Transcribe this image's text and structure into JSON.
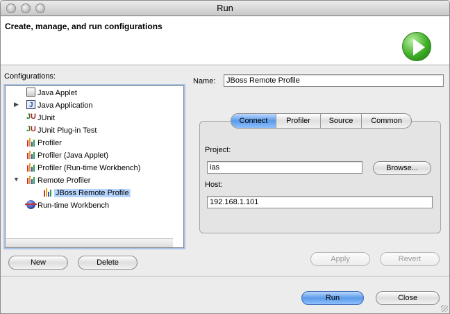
{
  "window": {
    "title": "Run"
  },
  "banner": {
    "title": "Create, manage, and run configurations"
  },
  "configurations": {
    "label": "Configurations:",
    "items": [
      {
        "label": "Java Applet",
        "icon": "applet-icon"
      },
      {
        "label": "Java Application",
        "icon": "java-app-icon",
        "collapsed": true
      },
      {
        "label": "JUnit",
        "icon": "junit-icon"
      },
      {
        "label": "JUnit Plug-in Test",
        "icon": "junit-plugin-icon"
      },
      {
        "label": "Profiler",
        "icon": "profiler-icon"
      },
      {
        "label": "Profiler (Java Applet)",
        "icon": "profiler-icon"
      },
      {
        "label": "Profiler (Run-time Workbench)",
        "icon": "profiler-icon"
      },
      {
        "label": "Remote Profiler",
        "icon": "profiler-icon",
        "expanded": true
      },
      {
        "label": "JBoss Remote Profile",
        "icon": "profiler-icon",
        "selected": true
      },
      {
        "label": "Run-time Workbench",
        "icon": "runtime-workbench-icon"
      }
    ],
    "new_label": "New",
    "delete_label": "Delete"
  },
  "details": {
    "name_label": "Name:",
    "name_value": "JBoss Remote Profile",
    "tabs": [
      {
        "label": "Connect",
        "active": true
      },
      {
        "label": "Profiler"
      },
      {
        "label": "Source"
      },
      {
        "label": "Common"
      }
    ],
    "project_label": "Project:",
    "project_value": "ias",
    "browse_label": "Browse...",
    "host_label": "Host:",
    "host_value": "192.168.1.101",
    "apply_label": "Apply",
    "revert_label": "Revert"
  },
  "footer": {
    "run_label": "Run",
    "close_label": "Close"
  },
  "colors": {
    "accent": "#5b9ae8",
    "selection": "#b5d5ff",
    "run_badge": "#3fae26"
  }
}
